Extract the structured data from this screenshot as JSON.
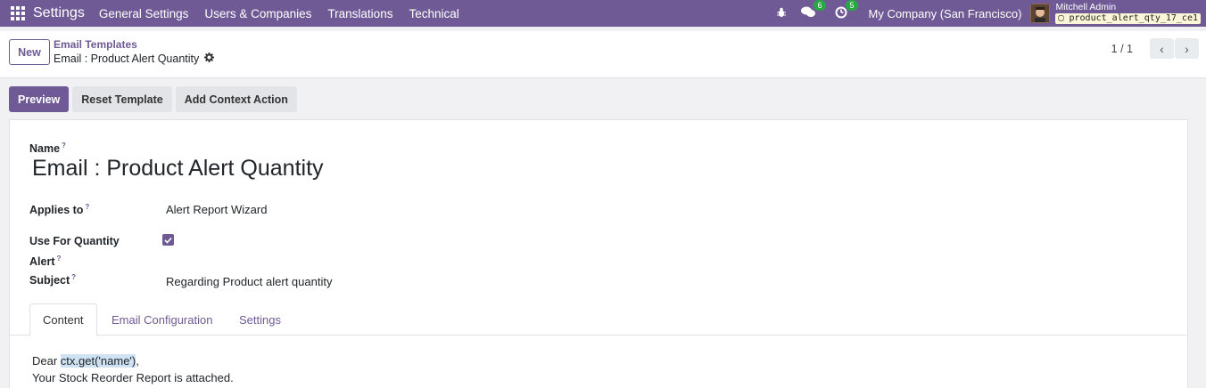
{
  "navbar": {
    "brand": "Settings",
    "items": [
      "General Settings",
      "Users & Companies",
      "Translations",
      "Technical"
    ],
    "messages_count": "6",
    "activities_count": "5",
    "company": "My Company (San Francisco)",
    "user_name": "Mitchell Admin",
    "database": "product_alert_qty_17_ce1"
  },
  "control_panel": {
    "new_label": "New",
    "breadcrumb": "Email Templates",
    "record_title": "Email : Product Alert Quantity",
    "pager": "1 / 1"
  },
  "actions": {
    "preview": "Preview",
    "reset": "Reset Template",
    "add_context": "Add Context Action"
  },
  "form": {
    "name_label": "Name",
    "name_value": "Email : Product Alert Quantity",
    "applies_to_label": "Applies to",
    "applies_to_value": "Alert Report Wizard",
    "use_for_label_1": "Use For Quantity",
    "use_for_label_2": "Alert",
    "use_for_checked": true,
    "subject_label": "Subject",
    "subject_value": "Regarding Product alert quantity",
    "help_mark": "?"
  },
  "tabs": [
    "Content",
    "Email Configuration",
    "Settings"
  ],
  "content": {
    "greeting": "Dear ",
    "placeholder": "ctx.get('name')",
    "greeting_end": ",",
    "line2": "Your Stock Reorder Report is attached."
  },
  "colors": {
    "brand": "#6f5a96",
    "badge": "#28a745"
  }
}
